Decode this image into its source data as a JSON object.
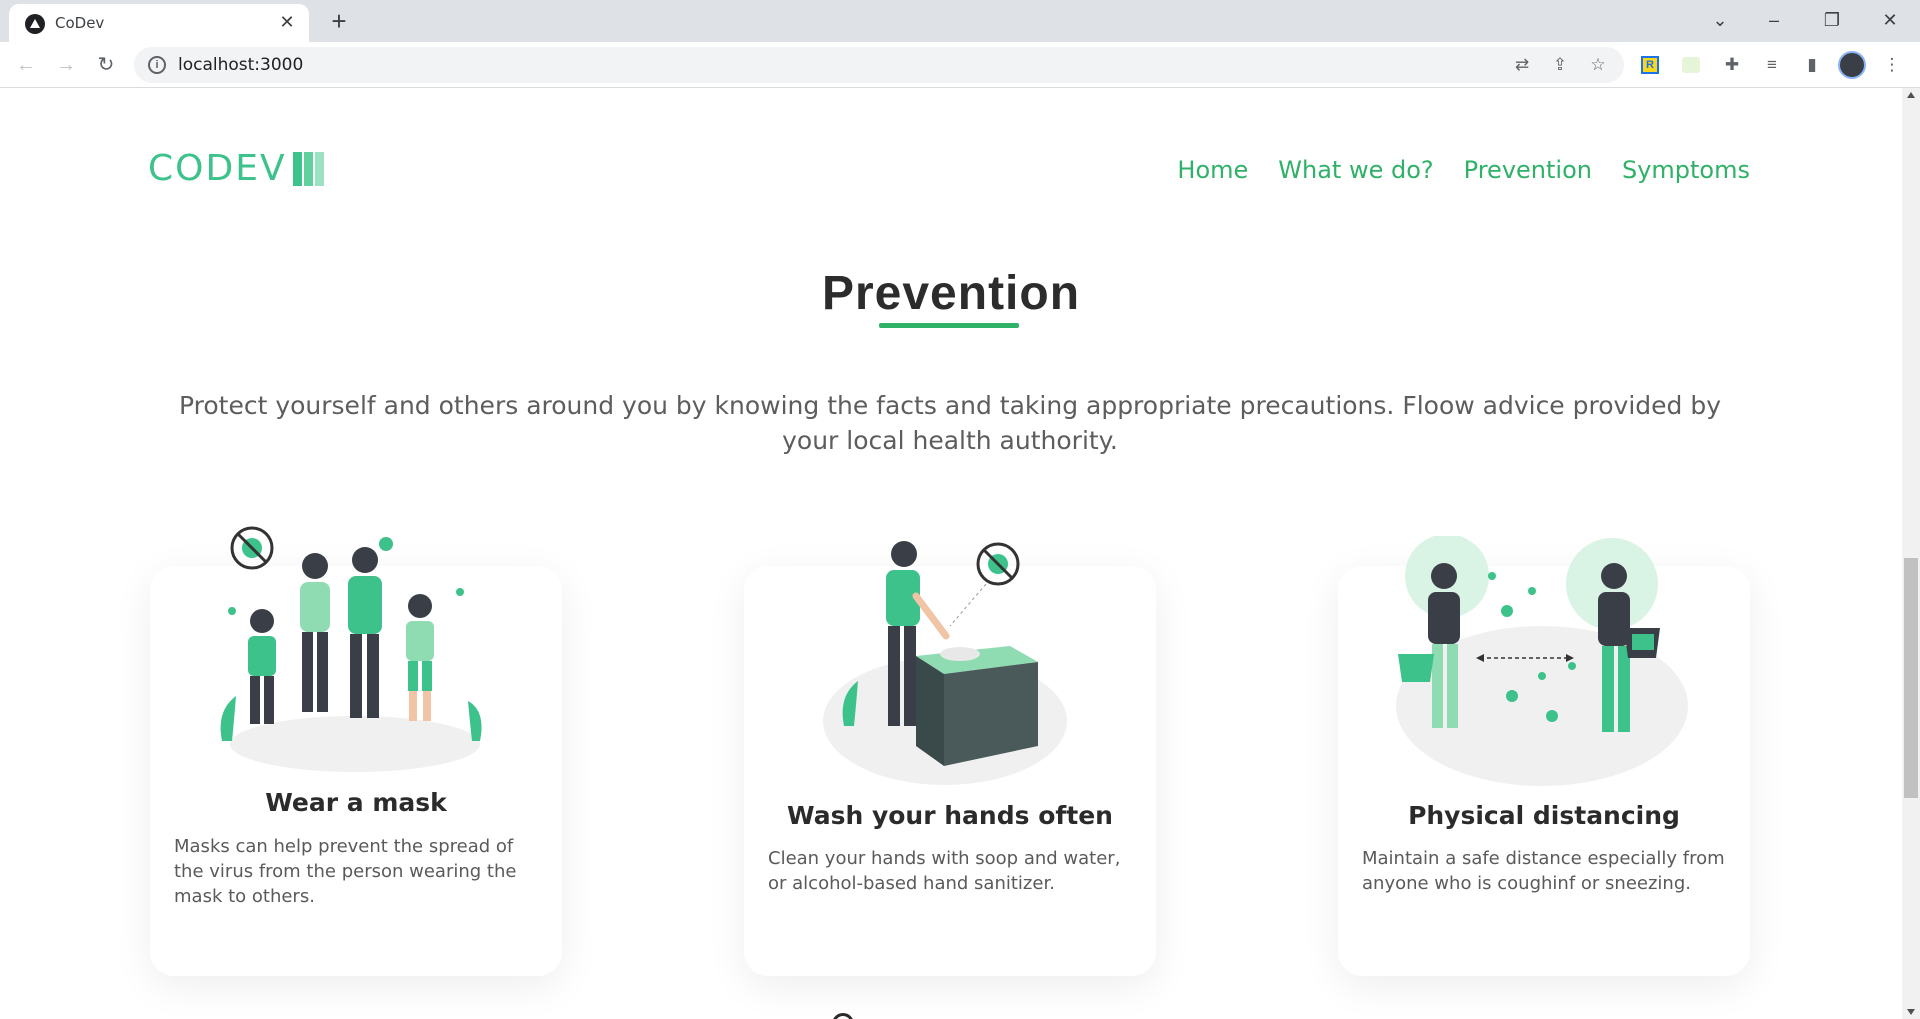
{
  "browser": {
    "tab_title": "CoDev",
    "url": "localhost:3000",
    "ext_label": "R"
  },
  "site": {
    "logo_text": "CODEV",
    "brand_colors": [
      "#3cc28a",
      "#2fb168",
      "#9be3c0"
    ],
    "nav": [
      "Home",
      "What we do?",
      "Prevention",
      "Symptoms"
    ]
  },
  "section": {
    "title": "Prevention",
    "lead": "Protect yourself and others around you by knowing the facts and taking appropriate precautions. Floow advice provided by your local health authority."
  },
  "cards": [
    {
      "icon": "people-wearing-masks-illustration",
      "title": "Wear a mask",
      "text": "Masks can help prevent the spread of the virus from the person wearing the mask to others."
    },
    {
      "icon": "hand-washing-illustration",
      "title": "Wash your hands often",
      "text": "Clean your hands with soop and water, or alcohol-based hand sanitizer."
    },
    {
      "icon": "physical-distancing-illustration",
      "title": "Physical distancing",
      "text": "Maintain a safe distance especially from anyone who is coughinf or sneezing."
    }
  ]
}
